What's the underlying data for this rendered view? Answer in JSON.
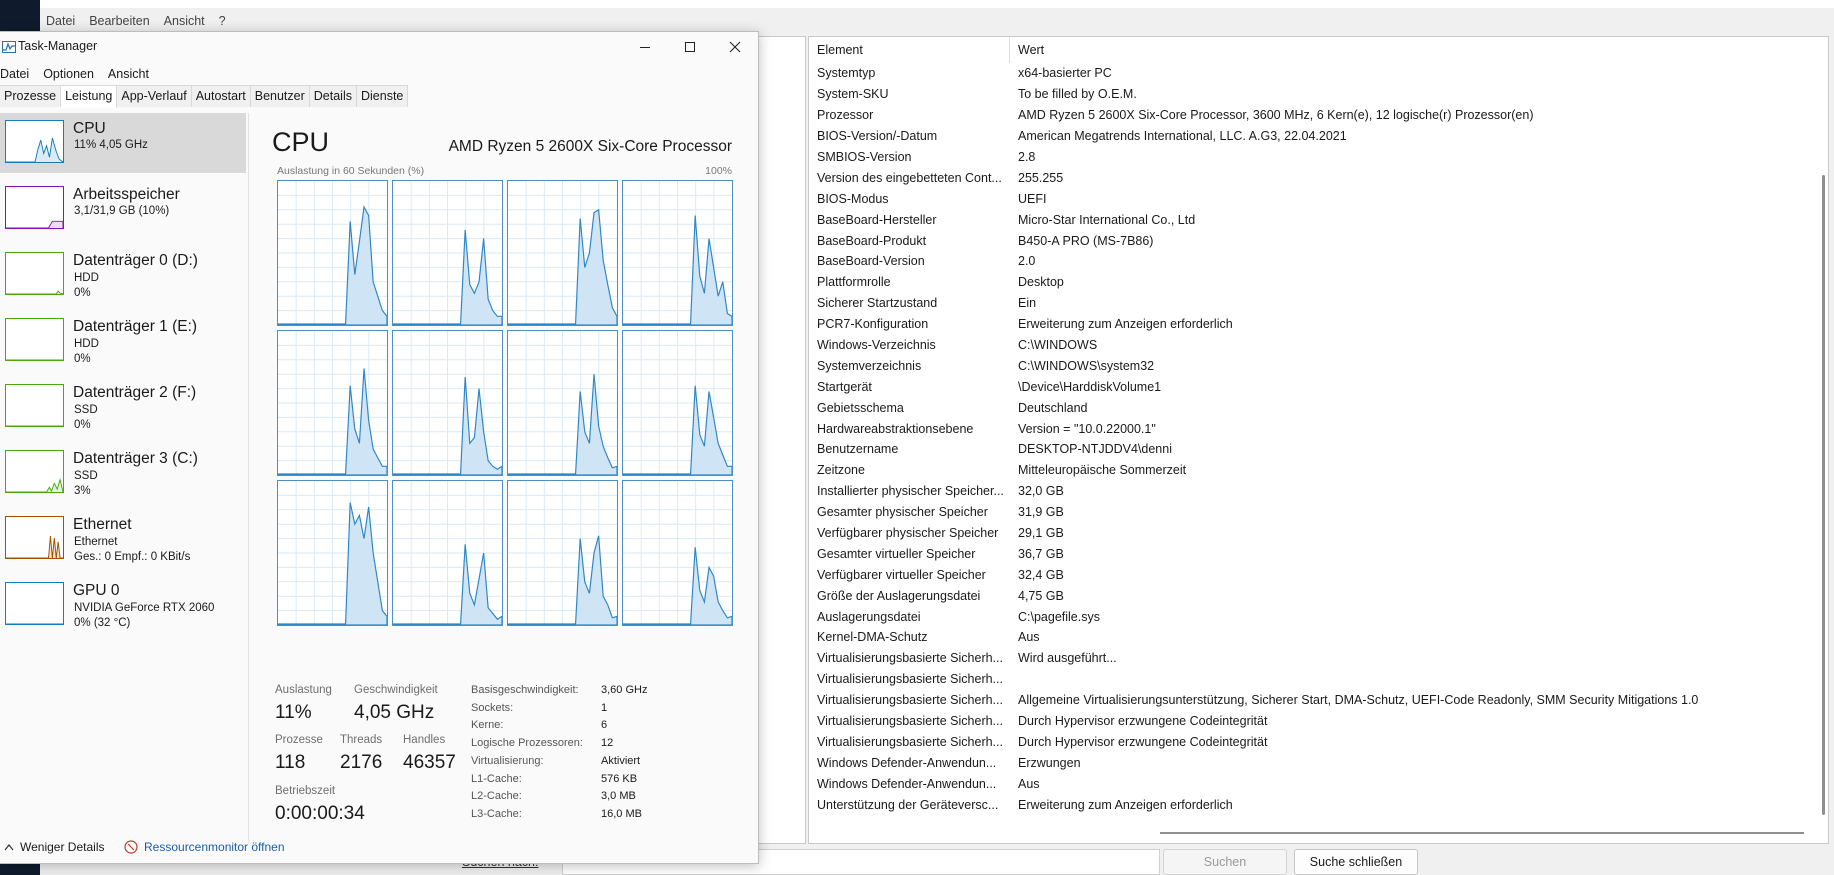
{
  "sysinfo": {
    "menu": [
      "Datei",
      "Bearbeiten",
      "Ansicht",
      "?"
    ],
    "columns": {
      "element": "Element",
      "value": "Wert"
    },
    "rows": [
      [
        "Systemtyp",
        "x64-basierter PC"
      ],
      [
        "System-SKU",
        "To be filled by O.E.M."
      ],
      [
        "Prozessor",
        "AMD Ryzen 5 2600X Six-Core Processor, 3600 MHz, 6 Kern(e), 12 logische(r) Prozessor(en)"
      ],
      [
        "BIOS-Version/-Datum",
        "American Megatrends International, LLC. A.G3, 22.04.2021"
      ],
      [
        "SMBIOS-Version",
        "2.8"
      ],
      [
        "Version des eingebetteten Cont...",
        "255.255"
      ],
      [
        "BIOS-Modus",
        "UEFI"
      ],
      [
        "BaseBoard-Hersteller",
        "Micro-Star International Co., Ltd"
      ],
      [
        "BaseBoard-Produkt",
        "B450-A PRO (MS-7B86)"
      ],
      [
        "BaseBoard-Version",
        "2.0"
      ],
      [
        "Plattformrolle",
        "Desktop"
      ],
      [
        "Sicherer Startzustand",
        "Ein"
      ],
      [
        "PCR7-Konfiguration",
        "Erweiterung zum Anzeigen erforderlich"
      ],
      [
        "Windows-Verzeichnis",
        "C:\\WINDOWS"
      ],
      [
        "Systemverzeichnis",
        "C:\\WINDOWS\\system32"
      ],
      [
        "Startgerät",
        "\\Device\\HarddiskVolume1"
      ],
      [
        "Gebietsschema",
        "Deutschland"
      ],
      [
        "Hardwareabstraktionsebene",
        "Version = \"10.0.22000.1\""
      ],
      [
        "Benutzername",
        "DESKTOP-NTJDDV4\\denni"
      ],
      [
        "Zeitzone",
        "Mitteleuropäische Sommerzeit"
      ],
      [
        "Installierter physischer Speicher...",
        "32,0 GB"
      ],
      [
        "Gesamter physischer Speicher",
        "31,9 GB"
      ],
      [
        "Verfügbarer physischer Speicher",
        "29,1 GB"
      ],
      [
        "Gesamter virtueller Speicher",
        "36,7 GB"
      ],
      [
        "Verfügbarer virtueller Speicher",
        "32,4 GB"
      ],
      [
        "Größe der Auslagerungsdatei",
        "4,75 GB"
      ],
      [
        "Auslagerungsdatei",
        "C:\\pagefile.sys"
      ],
      [
        "Kernel-DMA-Schutz",
        "Aus"
      ],
      [
        "Virtualisierungsbasierte Sicherh...",
        "Wird ausgeführt..."
      ],
      [
        "Virtualisierungsbasierte Sicherh...",
        ""
      ],
      [
        "Virtualisierungsbasierte Sicherh...",
        "Allgemeine Virtualisierungsunterstützung, Sicherer Start, DMA-Schutz, UEFI-Code Readonly, SMM Security Mitigations 1.0"
      ],
      [
        "Virtualisierungsbasierte Sicherh...",
        "Durch Hypervisor erzwungene Codeintegrität"
      ],
      [
        "Virtualisierungsbasierte Sicherh...",
        "Durch Hypervisor erzwungene Codeintegrität"
      ],
      [
        "Windows Defender-Anwendun...",
        "Erzwungen"
      ],
      [
        "Windows Defender-Anwendun...",
        "Aus"
      ],
      [
        "Unterstützung der Geräteversc...",
        "Erweiterung zum Anzeigen erforderlich"
      ]
    ],
    "search_label": "Suchen nach:",
    "search_button": "Suchen",
    "close_search_button": "Suche schließen"
  },
  "taskmanager": {
    "title": "Task-Manager",
    "menu": [
      "Datei",
      "Optionen",
      "Ansicht"
    ],
    "tabs": [
      "Prozesse",
      "Leistung",
      "App-Verlauf",
      "Autostart",
      "Benutzer",
      "Details",
      "Dienste"
    ],
    "active_tab": "Leistung",
    "resources": [
      {
        "name": "CPU",
        "sub1": "11% 4,05 GHz",
        "sub2": "",
        "color": "#117dbb",
        "selected": true
      },
      {
        "name": "Arbeitsspeicher",
        "sub1": "3,1/31,9 GB (10%)",
        "sub2": "",
        "color": "#8b12ae",
        "selected": false
      },
      {
        "name": "Datenträger 0 (D:)",
        "sub1": "HDD",
        "sub2": "0%",
        "color": "#4da60c",
        "selected": false
      },
      {
        "name": "Datenträger 1 (E:)",
        "sub1": "HDD",
        "sub2": "0%",
        "color": "#4da60c",
        "selected": false
      },
      {
        "name": "Datenträger 2 (F:)",
        "sub1": "SSD",
        "sub2": "0%",
        "color": "#4da60c",
        "selected": false
      },
      {
        "name": "Datenträger 3 (C:)",
        "sub1": "SSD",
        "sub2": "3%",
        "color": "#4da60c",
        "selected": false
      },
      {
        "name": "Ethernet",
        "sub1": "Ethernet",
        "sub2": "Ges.: 0 Empf.: 0 KBit/s",
        "color": "#a74f01",
        "selected": false
      },
      {
        "name": "GPU 0",
        "sub1": "NVIDIA GeForce RTX 2060",
        "sub2": "0% (32 °C)",
        "color": "#117dbb",
        "selected": false
      }
    ],
    "cpu": {
      "title": "CPU",
      "model": "AMD Ryzen 5 2600X Six-Core Processor",
      "graph_label": "Auslastung in 60 Sekunden (%)",
      "graph_max": "100%",
      "logical_processor_graphs": 12,
      "stats": {
        "utilization": {
          "label": "Auslastung",
          "value": "11%"
        },
        "speed": {
          "label": "Geschwindigkeit",
          "value": "4,05 GHz"
        },
        "processes": {
          "label": "Prozesse",
          "value": "118"
        },
        "threads": {
          "label": "Threads",
          "value": "2176"
        },
        "handles": {
          "label": "Handles",
          "value": "46357"
        },
        "uptime": {
          "label": "Betriebszeit",
          "value": "0:00:00:34"
        }
      },
      "info": [
        [
          "Basisgeschwindigkeit:",
          "3,60 GHz"
        ],
        [
          "Sockets:",
          "1"
        ],
        [
          "Kerne:",
          "6"
        ],
        [
          "Logische Prozessoren:",
          "12"
        ],
        [
          "Virtualisierung:",
          "Aktiviert"
        ],
        [
          "L1-Cache:",
          "576 KB"
        ],
        [
          "L2-Cache:",
          "3,0 MB"
        ],
        [
          "L3-Cache:",
          "16,0 MB"
        ]
      ]
    },
    "footer": {
      "fewer_details": "Weniger Details",
      "resource_monitor": "Ressourcenmonitor öffnen"
    }
  }
}
